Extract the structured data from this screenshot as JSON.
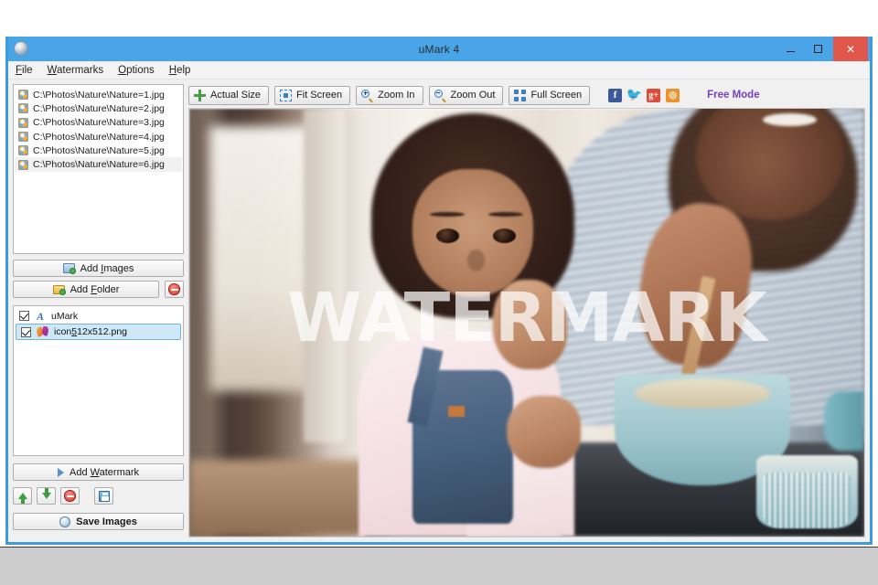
{
  "window": {
    "title": "uMark 4",
    "app_icon": "umark-app-icon",
    "controls": {
      "minimize": "minimize-button",
      "maximize": "maximize-button",
      "close": "close-button"
    },
    "accent_color": "#4aa5e8",
    "close_color": "#e2574c"
  },
  "menu": [
    {
      "label": "File",
      "accel": "F"
    },
    {
      "label": "Watermarks",
      "accel": "W"
    },
    {
      "label": "Options",
      "accel": "O"
    },
    {
      "label": "Help",
      "accel": "H"
    }
  ],
  "image_list": {
    "items": [
      {
        "path": "C:\\Photos\\Nature\\Nature=1.jpg",
        "selected": false
      },
      {
        "path": "C:\\Photos\\Nature\\Nature=2.jpg",
        "selected": false
      },
      {
        "path": "C:\\Photos\\Nature\\Nature=3.jpg",
        "selected": false
      },
      {
        "path": "C:\\Photos\\Nature\\Nature=4.jpg",
        "selected": false
      },
      {
        "path": "C:\\Photos\\Nature\\Nature=5.jpg",
        "selected": false
      },
      {
        "path": "C:\\Photos\\Nature\\Nature=6.jpg",
        "selected": true
      }
    ]
  },
  "left_buttons": {
    "add_images": {
      "pre": "Add ",
      "accel": "I",
      "post": "mages",
      "icon": "add-images-icon"
    },
    "add_folder": {
      "pre": "Add ",
      "accel": "F",
      "post": "older",
      "icon": "add-folder-icon"
    },
    "remove_images": {
      "icon": "remove-circle-icon"
    }
  },
  "watermark_list": {
    "items": [
      {
        "label": "uMark",
        "checked": true,
        "selected": false,
        "icon": "text-watermark-icon"
      },
      {
        "label_pre": "icon",
        "accel": "5",
        "label_post": "12x512.png",
        "label": "icon512x512.png",
        "checked": true,
        "selected": true,
        "icon": "image-watermark-icon"
      }
    ]
  },
  "watermark_buttons": {
    "add_watermark": {
      "pre": "Add ",
      "accel": "W",
      "post": "atermark",
      "icon": "add-watermark-icon"
    },
    "move_up": {
      "icon": "arrow-up-icon"
    },
    "move_down": {
      "icon": "arrow-down-icon"
    },
    "delete": {
      "icon": "remove-circle-icon"
    },
    "save_preset": {
      "icon": "floppy-disk-icon"
    },
    "save_images": {
      "label": "Save Images",
      "icon": "save-images-icon"
    }
  },
  "toolbar": {
    "buttons": [
      {
        "label": "Actual Size",
        "icon": "actual-size-icon"
      },
      {
        "label": "Fit Screen",
        "icon": "fit-screen-icon"
      },
      {
        "label": "Zoom In",
        "icon": "zoom-in-icon"
      },
      {
        "label": "Zoom Out",
        "icon": "zoom-out-icon"
      },
      {
        "label": "Full Screen",
        "icon": "full-screen-icon"
      }
    ],
    "social": [
      {
        "name": "facebook",
        "glyph": "f",
        "color": "#3b5998"
      },
      {
        "name": "twitter",
        "glyph": "ᴠ",
        "color": "#55acee"
      },
      {
        "name": "googleplus",
        "glyph": "g+",
        "color": "#dd4b39"
      },
      {
        "name": "rss",
        "glyph": "◜",
        "color": "#f0922b"
      }
    ],
    "mode_label": "Free Mode",
    "mode_color": "#7a3fbf"
  },
  "preview": {
    "watermark_text": "WATERMARK",
    "watermark_opacity": "0.72",
    "photo_description": "child-baking-with-adult-photo"
  }
}
